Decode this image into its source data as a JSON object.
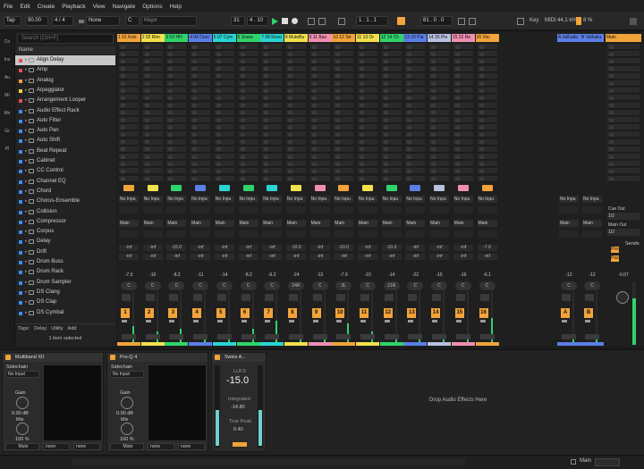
{
  "menu": [
    "File",
    "Edit",
    "Create",
    "Playback",
    "View",
    "Navigate",
    "Options",
    "Help"
  ],
  "transport": {
    "tap": "Tap",
    "tempo": "90.00",
    "signature": "4 / 4",
    "metronome": "None",
    "scale_key": "C",
    "scale_mode": "Major",
    "bars": "31",
    "position": "4 . 10",
    "arr_start": "1 . 1 . 1",
    "loop_len": "81 . 0 . 0",
    "key_label": "Key",
    "midi_label": "MIDI",
    "sample_rate": "44.1 kHz",
    "cpu": "8 %",
    "colors": {
      "play": "#30d36a",
      "accent": "#f2a33a"
    }
  },
  "browser": {
    "search_placeholder": "Search (Ctrl+F)",
    "column_header": "Name",
    "categories": [
      "Co",
      "Ins",
      "Au",
      "MI",
      "Mx",
      "Gr",
      "Pl"
    ],
    "items": [
      {
        "name": "Align Delay",
        "color": "#e35050",
        "selected": true
      },
      {
        "name": "Amp",
        "color": "#e35050"
      },
      {
        "name": "Analog",
        "color": "#f2a33a"
      },
      {
        "name": "Arpeggiator",
        "color": "#f2d03a"
      },
      {
        "name": "Arrangement Looper",
        "color": "#e35050"
      },
      {
        "name": "Audio Effect Rack",
        "color": "#3a8ef2"
      },
      {
        "name": "Auto Filter",
        "color": "#3a8ef2"
      },
      {
        "name": "Auto Pan",
        "color": "#3a8ef2"
      },
      {
        "name": "Auto Shift",
        "color": "#3a8ef2"
      },
      {
        "name": "Beat Repeat",
        "color": "#3a8ef2"
      },
      {
        "name": "Cabinet",
        "color": "#3a8ef2"
      },
      {
        "name": "CC Control",
        "color": "#3a8ef2"
      },
      {
        "name": "Channel EQ",
        "color": "#3a8ef2"
      },
      {
        "name": "Chord",
        "color": "#3a8ef2"
      },
      {
        "name": "Chorus-Ensemble",
        "color": "#3a8ef2"
      },
      {
        "name": "Collision",
        "color": "#3a8ef2"
      },
      {
        "name": "Compressor",
        "color": "#3a8ef2"
      },
      {
        "name": "Corpus",
        "color": "#3a8ef2"
      },
      {
        "name": "Delay",
        "color": "#3a8ef2"
      },
      {
        "name": "Drift",
        "color": "#3a8ef2"
      },
      {
        "name": "Drum Buss",
        "color": "#3a8ef2"
      },
      {
        "name": "Drum Rack",
        "color": "#3a8ef2"
      },
      {
        "name": "Drum Sampler",
        "color": "#3a8ef2"
      },
      {
        "name": "DS Clang",
        "color": "#3a8ef2"
      },
      {
        "name": "DS Clap",
        "color": "#3a8ef2"
      },
      {
        "name": "DS Cymbal",
        "color": "#3a8ef2"
      }
    ],
    "tags_label": "Tags:",
    "tags": [
      "Delay",
      "Utility",
      "Add"
    ],
    "selected_info": "1 item selected"
  },
  "tracks": [
    {
      "name": "1 01 Kick",
      "color": "#f2a33a",
      "num": "1",
      "vol": "-7.3",
      "pan": "C",
      "send_a": "-inf",
      "send_b": "-inf",
      "level": 0.35
    },
    {
      "name": "2 02 Rim",
      "color": "#f2e14c",
      "num": "2",
      "vol": "-10",
      "pan": "C",
      "send_a": "-inf",
      "send_b": "-inf",
      "level": 0.25
    },
    {
      "name": "3 03 HH",
      "color": "#30d36a",
      "num": "3",
      "vol": "-8.2",
      "pan": "C",
      "send_a": "-15.0",
      "send_b": "-inf",
      "level": 0.3
    },
    {
      "name": "4 04 Dum",
      "color": "#5b7fe8",
      "num": "4",
      "vol": "-11",
      "pan": "C",
      "send_a": "-inf",
      "send_b": "-inf",
      "level": 0.2
    },
    {
      "name": "5 07 Cym",
      "color": "#2ad4d4",
      "num": "5",
      "vol": "-14",
      "pan": "C",
      "send_a": "-inf",
      "send_b": "-inf",
      "level": 0.15
    },
    {
      "name": "6 Snare",
      "color": "#30d36a",
      "num": "6",
      "vol": "-8.2",
      "pan": "C",
      "send_a": "-inf",
      "send_b": "-inf",
      "level": 0.3
    },
    {
      "name": "7 08 Reso",
      "color": "#2ad4d4",
      "num": "7",
      "vol": "-6.2",
      "pan": "C",
      "send_a": "-inf",
      "send_b": "-inf",
      "level": 0.45
    },
    {
      "name": "8 MuteBu",
      "color": "#f2e14c",
      "num": "8",
      "vol": "-24",
      "pan": "24R",
      "send_a": "-10.0",
      "send_b": "-inf",
      "level": 0.1
    },
    {
      "name": "9 11 Bas",
      "color": "#ef8fb0",
      "num": "9",
      "vol": "-13",
      "pan": "C",
      "send_a": "-inf",
      "send_b": "-inf",
      "level": 0.2
    },
    {
      "name": "10 12 Str",
      "color": "#f2a33a",
      "num": "10",
      "vol": "-7.9",
      "pan": "3L",
      "send_a": "-10.0",
      "send_b": "-inf",
      "level": 0.4
    },
    {
      "name": "11 13 Or",
      "color": "#f2e14c",
      "num": "11",
      "vol": "-10",
      "pan": "C",
      "send_a": "-inf",
      "send_b": "-inf",
      "level": 0.25
    },
    {
      "name": "12 14 Ch",
      "color": "#30d36a",
      "num": "12",
      "vol": "-14",
      "pan": "21R",
      "send_a": "-10.0",
      "send_b": "-inf",
      "level": 0.2
    },
    {
      "name": "13 15 Pia",
      "color": "#5b7fe8",
      "num": "13",
      "vol": "-22",
      "pan": "C",
      "send_a": "-inf",
      "send_b": "-inf",
      "level": 0.1
    },
    {
      "name": "14 35 Pio",
      "color": "#b9c0e0",
      "num": "14",
      "vol": "-15",
      "pan": "C",
      "send_a": "-inf",
      "send_b": "-inf",
      "level": 0.2
    },
    {
      "name": "15 22 Re",
      "color": "#ef8fb0",
      "num": "15",
      "vol": "-16",
      "pan": "C",
      "send_a": "-inf",
      "send_b": "-inf",
      "level": 0.15
    },
    {
      "name": "16 Voc",
      "color": "#f2a33a",
      "num": "16",
      "vol": "-6.1",
      "pan": "C",
      "send_a": "-7.0",
      "send_b": "-inf",
      "level": 0.5
    }
  ],
  "returns": [
    {
      "name": "A Valhalla",
      "color": "#5b7fe8",
      "num": "A",
      "vol": "-12",
      "pan": "C",
      "level": 0.2
    },
    {
      "name": "B Valhalla",
      "color": "#5b7fe8",
      "num": "B",
      "vol": "-12",
      "pan": "C",
      "level": 0.2
    }
  ],
  "master": {
    "name": "Main",
    "color": "#f2a33a",
    "vol": "-0.07",
    "pan": "0",
    "cue_out_label": "Cue Out",
    "cue_out": "1/2",
    "main_out_label": "Main Out",
    "main_out": "1/2",
    "sends_label": "Sends",
    "post": "Post",
    "level": 0.75
  },
  "io_labels": {
    "input": "No Inpu",
    "input_ret": "No Inpu",
    "output": "Main"
  },
  "devices": {
    "multiband": {
      "name": "Multiband XII",
      "sidechain_label": "Sidechain",
      "sidechain_value": "No Input",
      "gain_label": "Gain",
      "gain_value": "0.00 dB",
      "mix_label": "Mix",
      "mix_value": "100 %",
      "mute": "Mute",
      "none1": "none",
      "none2": "none"
    },
    "proq": {
      "name": "Pro-Q 4",
      "sidechain_label": "Sidechain",
      "sidechain_value": "No Input",
      "gain_label": "Gain",
      "gain_value": "0.00 dB",
      "mix_label": "Mix",
      "mix_value": "100 %",
      "mute": "Mute",
      "none1": "none",
      "none2": "none"
    },
    "swiss": {
      "name": "Swiss A...",
      "lufs_label": "LUFS",
      "lufs_value": "-15.0",
      "integrated_label": "Integrated",
      "integrated_value": "-14.80",
      "truepeak_label": "True Peak",
      "truepeak_value": "0.40"
    },
    "drop_hint": "Drop Audio Effects Here"
  },
  "statusbar": {
    "output_label": "Main"
  }
}
